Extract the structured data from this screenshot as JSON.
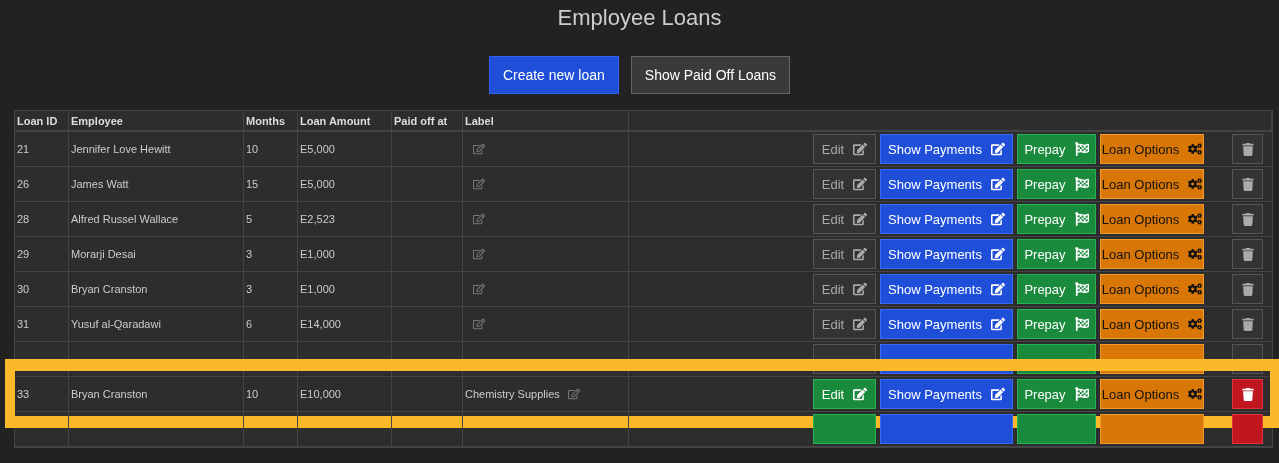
{
  "title": "Employee Loans",
  "toolbar": [
    {
      "label": "Create new loan",
      "kind": "primary"
    },
    {
      "label": "Show Paid Off Loans",
      "kind": "secondary"
    }
  ],
  "table": {
    "columns": [
      "Loan ID",
      "Employee",
      "Months",
      "Loan Amount",
      "Paid off at",
      "Label"
    ],
    "rows": [
      {
        "id": "21",
        "employee": "Jennifer Love Hewitt",
        "months": "10",
        "amount": "E5,000",
        "labeled": false,
        "annotated": false,
        "covered": false,
        "buttons": [
          {
            "kind": "edit",
            "label": "Edit"
          },
          {
            "kind": "payments",
            "label": "Show Payments"
          },
          {
            "kind": "prepay",
            "label": "Prepay"
          },
          {
            "kind": "options",
            "label": "Loan Options"
          },
          {
            "kind": "delete"
          }
        ]
      },
      {
        "id": "26",
        "employee": "James Watt",
        "months": "15",
        "amount": "E5,000",
        "labeled": false,
        "annotated": false,
        "covered": false,
        "buttons": [
          {
            "kind": "edit",
            "label": "Edit"
          },
          {
            "kind": "payments",
            "label": "Show Payments"
          },
          {
            "kind": "prepay",
            "label": "Prepay"
          },
          {
            "kind": "options",
            "label": "Loan Options"
          },
          {
            "kind": "delete"
          }
        ]
      },
      {
        "id": "28",
        "employee": "Alfred Russel Wallace",
        "months": "5",
        "amount": "E2,523",
        "labeled": false,
        "annotated": false,
        "covered": false,
        "buttons": [
          {
            "kind": "edit",
            "label": "Edit"
          },
          {
            "kind": "payments",
            "label": "Show Payments"
          },
          {
            "kind": "prepay",
            "label": "Prepay"
          },
          {
            "kind": "options",
            "label": "Loan Options"
          },
          {
            "kind": "delete"
          }
        ]
      },
      {
        "id": "29",
        "employee": "Morarji Desai",
        "months": "3",
        "amount": "E1,000",
        "labeled": false,
        "annotated": false,
        "covered": false,
        "buttons": [
          {
            "kind": "edit",
            "label": "Edit"
          },
          {
            "kind": "payments",
            "label": "Show Payments"
          },
          {
            "kind": "prepay",
            "label": "Prepay"
          },
          {
            "kind": "options",
            "label": "Loan Options"
          },
          {
            "kind": "delete"
          }
        ]
      },
      {
        "id": "30",
        "employee": "Bryan Cranston",
        "months": "3",
        "amount": "E1,000",
        "labeled": false,
        "annotated": false,
        "covered": false,
        "buttons": [
          {
            "kind": "edit",
            "label": "Edit"
          },
          {
            "kind": "payments",
            "label": "Show Payments"
          },
          {
            "kind": "prepay",
            "label": "Prepay"
          },
          {
            "kind": "options",
            "label": "Loan Options"
          },
          {
            "kind": "delete"
          }
        ]
      },
      {
        "id": "31",
        "employee": "Yusuf al-Qaradawi",
        "months": "6",
        "amount": "E14,000",
        "labeled": false,
        "annotated": false,
        "covered": false,
        "buttons": [
          {
            "kind": "edit",
            "label": "Edit"
          },
          {
            "kind": "payments",
            "label": "Show Payments"
          },
          {
            "kind": "prepay",
            "label": "Prepay"
          },
          {
            "kind": "options",
            "label": "Loan Options"
          },
          {
            "kind": "delete"
          }
        ]
      },
      {
        "labeled": false,
        "annotated": false,
        "covered": true,
        "buttons": [
          {
            "kind": "edit"
          },
          {
            "kind": "payments"
          },
          {
            "kind": "prepay"
          },
          {
            "kind": "options"
          },
          {
            "kind": "delete"
          }
        ]
      },
      {
        "id": "33",
        "employee": "Bryan Cranston",
        "months": "10",
        "amount": "E10,000",
        "label": "Chemistry Supplies",
        "labeled": true,
        "annotated": true,
        "covered": false,
        "buttons": [
          {
            "kind": "edit",
            "label": "Edit"
          },
          {
            "kind": "payments",
            "label": "Show Payments"
          },
          {
            "kind": "prepay",
            "label": "Prepay"
          },
          {
            "kind": "options",
            "label": "Loan Options"
          },
          {
            "kind": "delete"
          }
        ]
      },
      {
        "labeled": true,
        "annotated": false,
        "covered": true,
        "buttons": [
          {
            "kind": "edit"
          },
          {
            "kind": "payments"
          },
          {
            "kind": "prepay"
          },
          {
            "kind": "options"
          },
          {
            "kind": "delete"
          }
        ]
      }
    ]
  }
}
